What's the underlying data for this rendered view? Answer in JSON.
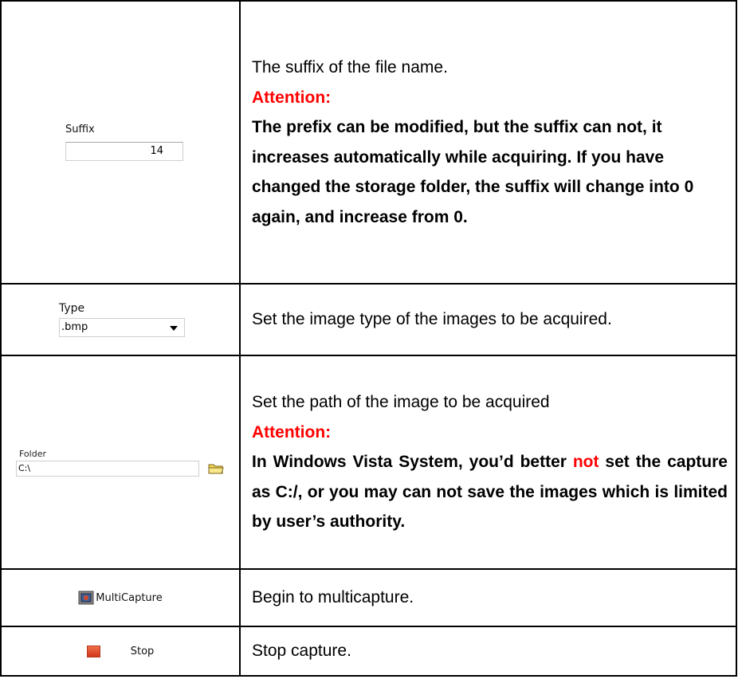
{
  "rows": [
    {
      "widget": {
        "label": "Suffix",
        "value": "14"
      },
      "text": {
        "intro": "The suffix of the file name.",
        "attention": "Attention:",
        "body": "The prefix can be modified, but the suffix can not, it increases automatically while acquiring. If you have changed the storage folder, the suffix will change into 0 again, and increase from 0."
      }
    },
    {
      "widget": {
        "label": "Type",
        "value": ".bmp"
      },
      "text": {
        "intro": "Set the image type of the images to be acquired."
      }
    },
    {
      "widget": {
        "label": "Folder",
        "value": "C:\\"
      },
      "text": {
        "intro": "Set the path of the image to be acquired",
        "attention": "Attention:",
        "body_before": "In Windows Vista System, you’d better",
        "body_red": "not",
        "body_after": "set the capture as C:/, or you may can not save the images which is limited by user’s authority."
      }
    },
    {
      "widget": {
        "label": "MultiCapture",
        "icon": "multicapture-icon"
      },
      "text": {
        "intro": "Begin to multicapture."
      }
    },
    {
      "widget": {
        "label": "Stop",
        "icon": "stop-icon"
      },
      "text": {
        "intro": "Stop capture."
      }
    }
  ],
  "colors": {
    "attention": "#ff0000",
    "border": "#000000"
  }
}
